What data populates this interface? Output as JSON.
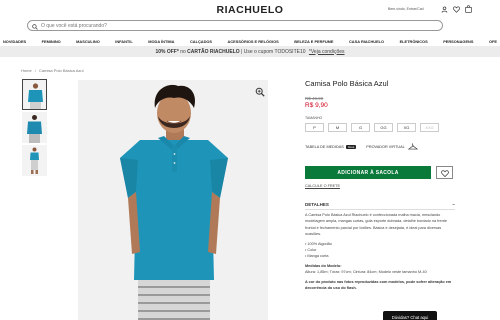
{
  "header": {
    "logo": "RIACHUELO",
    "account_link": "Bem-vindo, Entrar/Cad",
    "search_placeholder": "O que você está procurando?"
  },
  "nav": {
    "items": [
      "NOVIDADES",
      "FEMININO",
      "MASCULINO",
      "INFANTIL",
      "MODA ÍNTIMA",
      "CALÇADOS",
      "ACESSÓRIOS E RELÓGIOS",
      "BELEZA E PERFUME",
      "CASA RIACHUELO",
      "ELETRÔNICOS",
      "PERSONAGENS",
      "OFE"
    ]
  },
  "promo": {
    "highlight": "10% OFF*",
    "text_mid": " no ",
    "card": "CARTÃO RIACHUELO",
    "text_end": " | Use o cupom TODOSITE10 ",
    "link": "*Veja condições"
  },
  "breadcrumb": {
    "home": "Home",
    "separator": "/",
    "current": "Camisa Polo Básica Azul"
  },
  "product": {
    "title": "Camisa Polo Básica Azul",
    "old_price": "R$ 49,90",
    "new_price": "R$ 9,90",
    "size_label": "TAMANHO",
    "sizes": [
      {
        "label": "P",
        "available": true
      },
      {
        "label": "M",
        "available": true
      },
      {
        "label": "G",
        "available": true
      },
      {
        "label": "GG",
        "available": true
      },
      {
        "label": "XG",
        "available": true
      },
      {
        "label": "XXG",
        "available": false
      }
    ],
    "measures_label": "TABELA DE MEDIDAS",
    "measures_tag": "Nova",
    "virtual_label": "PROVADOR VIRTUAL",
    "add_button": "ADICIONAR À SACOLA",
    "shipping_link": "CALCULE O FRETE"
  },
  "details": {
    "heading": "DETALHES",
    "toggle": "−",
    "intro": "A  Camisa Polo Básica Azul Riachuelo  é confeccionada malha macia, mesclando modelagem ampla, mangas curtas, gola esporte dobrada, detalhe bordado na frente frontal e fechamento parcial por botões. Básica e desejada, é ideal para diversas ocasiões.",
    "bullets": [
      "• 100% Algodão",
      "• Color",
      "• Manga curta"
    ],
    "model_heading": "Medidas do Modelo:",
    "model_text": "Altura: 1,85m; Tórax: 97cm; Cintura: 84cm; Modelo veste tamanho M-40",
    "note": "A cor do produto nas fotos reproduzidas com modelos, pode sofrer alteração em decorrência do uso do flash."
  },
  "chat": {
    "label": "Dúvidas? Chat aqui"
  },
  "colors": {
    "shirt": "#1e95b8",
    "add_button": "#0a7a3a",
    "price": "#d0021b"
  }
}
